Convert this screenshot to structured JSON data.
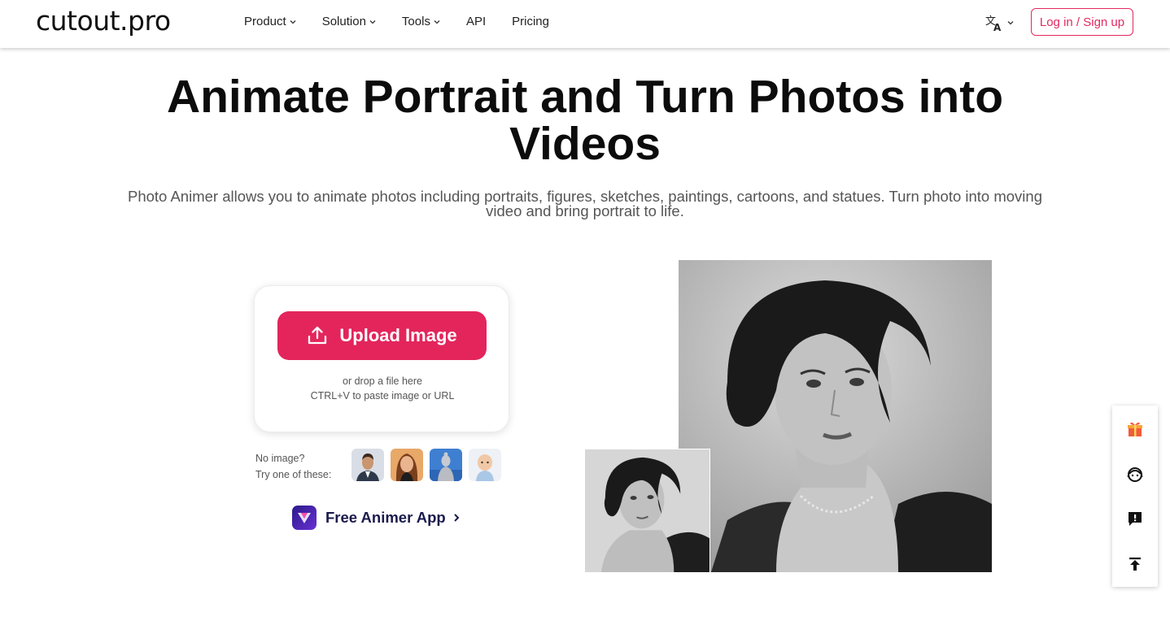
{
  "header": {
    "logo": "cutout.pro",
    "nav": [
      {
        "label": "Product",
        "dropdown": true
      },
      {
        "label": "Solution",
        "dropdown": true
      },
      {
        "label": "Tools",
        "dropdown": true
      },
      {
        "label": "API",
        "dropdown": false
      },
      {
        "label": "Pricing",
        "dropdown": false
      }
    ],
    "language_icon": "translate-icon",
    "login_label": "Log in / Sign up"
  },
  "hero": {
    "title": "Animate Portrait and Turn Photos into Videos",
    "subtitle": "Photo Animer allows you to animate photos including portraits, figures, sketches, paintings, cartoons, and statues. Turn photo into moving video and bring portrait to life."
  },
  "upload": {
    "button_label": "Upload Image",
    "button_icon": "upload-icon",
    "hint_drop": "or drop a file here",
    "hint_paste": "CTRL+V to paste image or URL"
  },
  "samples": {
    "label_line1": "No image?",
    "label_line2": "Try one of these:",
    "items": [
      "man-in-suit",
      "woman-portrait",
      "statue",
      "baby"
    ]
  },
  "app_link": {
    "label": "Free Animer App",
    "icon": "animer-app-icon"
  },
  "side_toolbar": {
    "items": [
      "gift-icon",
      "support-agent-icon",
      "feedback-icon",
      "back-to-top-icon"
    ]
  },
  "colors": {
    "accent": "#e3255c",
    "brand_dark": "#1a1a4d",
    "text": "#111111",
    "muted": "#555555"
  }
}
